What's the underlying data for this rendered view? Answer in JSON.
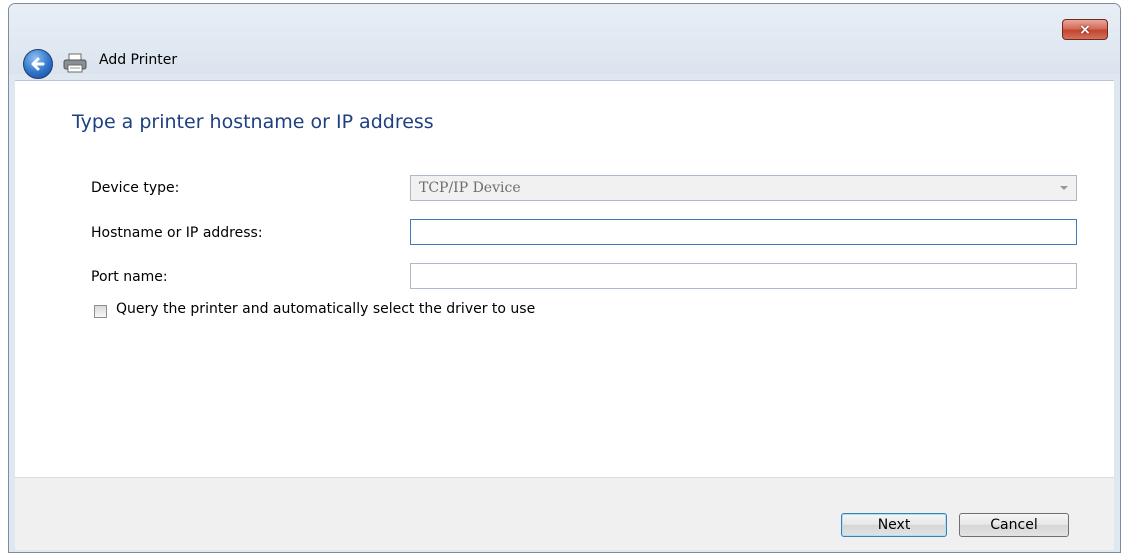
{
  "window": {
    "title": "Add Printer",
    "close_glyph": "×"
  },
  "page": {
    "heading": "Type a printer hostname or IP address",
    "device_type": {
      "label": "Device type:",
      "value": "TCP/IP Device"
    },
    "hostname": {
      "label": "Hostname or IP address:",
      "value": ""
    },
    "port_name": {
      "label": "Port name:",
      "value": ""
    },
    "query_checkbox": {
      "label": "Query the printer and automatically select the driver to use",
      "checked": false
    }
  },
  "footer": {
    "next_label": "Next",
    "cancel_label": "Cancel"
  },
  "icons": {
    "back": "back-arrow-icon",
    "printer": "printer-icon",
    "close": "close-icon",
    "dropdown": "chevron-down-icon"
  },
  "colors": {
    "heading": "#1e3f82",
    "close_button": "#c14630",
    "back_button": "#2e74c9"
  }
}
